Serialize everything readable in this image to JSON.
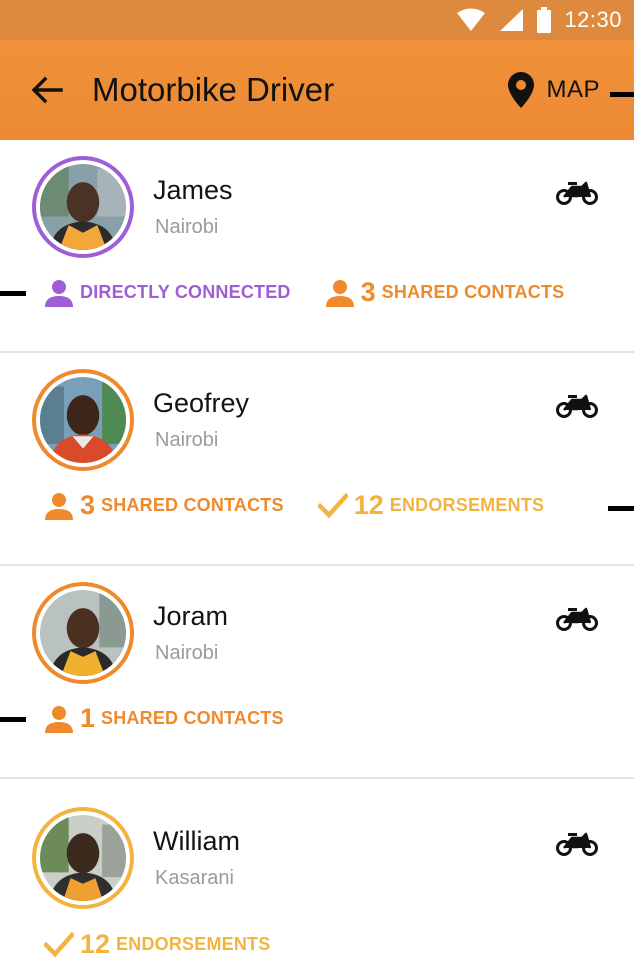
{
  "status_bar": {
    "time": "12:30"
  },
  "app_bar": {
    "title": "Motorbike Driver",
    "map_label": "MAP"
  },
  "drivers": [
    {
      "name": "James",
      "location": "Nairobi",
      "ring_color": "#9f5ed6",
      "badges": [
        {
          "type": "connection",
          "icon": "person-icon",
          "color": "#9f5ed6",
          "label": "DIRECTLY CONNECTED"
        },
        {
          "type": "shared",
          "icon": "person-icon",
          "color": "#ef8a2c",
          "count": "3",
          "label": "SHARED CONTACTS"
        }
      ]
    },
    {
      "name": "Geofrey",
      "location": "Nairobi",
      "ring_color": "#ef8a2c",
      "badges": [
        {
          "type": "shared",
          "icon": "person-icon",
          "color": "#ef8a2c",
          "count": "3",
          "label": "SHARED CONTACTS"
        },
        {
          "type": "endorse",
          "icon": "check-icon",
          "color": "#f2b43e",
          "count": "12",
          "label": "ENDORSEMENTS"
        }
      ]
    },
    {
      "name": "Joram",
      "location": "Nairobi",
      "ring_color": "#ef8a2c",
      "badges": [
        {
          "type": "shared",
          "icon": "person-icon",
          "color": "#ef8a2c",
          "count": "1",
          "label": "SHARED CONTACTS"
        }
      ]
    },
    {
      "name": "William",
      "location": "Kasarani",
      "ring_color": "#f2b43e",
      "badges": [
        {
          "type": "endorse",
          "icon": "check-icon",
          "color": "#f2b43e",
          "count": "12",
          "label": "ENDORSEMENTS"
        }
      ]
    }
  ]
}
